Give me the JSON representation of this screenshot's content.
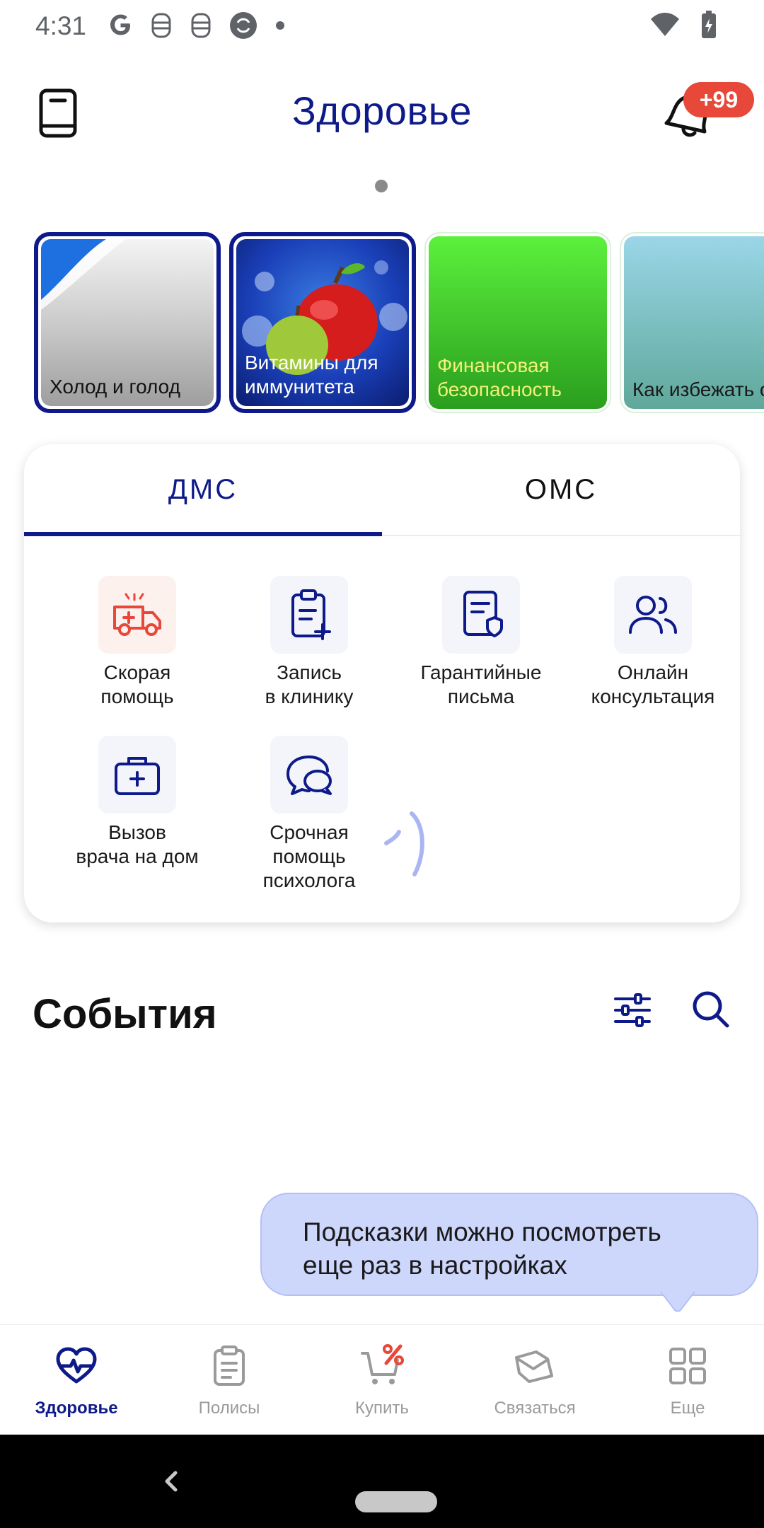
{
  "status_bar": {
    "time": "4:31",
    "icons": [
      "google-icon",
      "mask-icon",
      "mask-icon",
      "vpn-icon",
      "dot-icon",
      "wifi-icon",
      "battery-charging-icon"
    ]
  },
  "header": {
    "title": "Здоровье",
    "notifications_badge": "+99"
  },
  "stories": [
    {
      "label": "Холод и голод",
      "state": "active"
    },
    {
      "label": "Витамины для иммунитета",
      "state": "active"
    },
    {
      "label": "Финансовая безопасность",
      "state": "seen"
    },
    {
      "label": "Как избежать обморожения",
      "state": "seen"
    }
  ],
  "tabs": {
    "dms": "ДМС",
    "oms": "ОМС",
    "selected": "ДМС"
  },
  "services": [
    {
      "label_line1": "Скорая",
      "label_line2": "помощь",
      "label_line3": "",
      "icon": "ambulance-icon"
    },
    {
      "label_line1": "Запись",
      "label_line2": "в клинику",
      "label_line3": "",
      "icon": "clipboard-plus-icon"
    },
    {
      "label_line1": "Гарантийные",
      "label_line2": "письма",
      "label_line3": "",
      "icon": "document-shield-icon"
    },
    {
      "label_line1": "Онлайн",
      "label_line2": "консультация",
      "label_line3": "",
      "icon": "users-icon"
    },
    {
      "label_line1": "Вызов",
      "label_line2": "врача на дом",
      "label_line3": "",
      "icon": "medical-bag-icon"
    },
    {
      "label_line1": "Срочная",
      "label_line2": "помощь",
      "label_line3": "психолога",
      "icon": "chat-bubbles-icon"
    }
  ],
  "events": {
    "title": "События"
  },
  "tooltip": {
    "text_line1": "Подсказки можно посмотреть",
    "text_line2": "еще раз в настройках"
  },
  "bottom_nav": [
    {
      "label": "Здоровье",
      "icon": "heart-pulse-icon",
      "active": true
    },
    {
      "label": "Полисы",
      "icon": "clipboard-icon",
      "active": false
    },
    {
      "label": "Купить",
      "icon": "cart-percent-icon",
      "active": false
    },
    {
      "label": "Связаться",
      "icon": "envelope-icon",
      "active": false
    },
    {
      "label": "Еще",
      "icon": "grid-icon",
      "active": false
    }
  ],
  "colors": {
    "primary": "#0e1a8a",
    "badge": "#e8483a",
    "tooltip_bg": "#cdd6fb",
    "inactive": "#9a9a9a"
  }
}
